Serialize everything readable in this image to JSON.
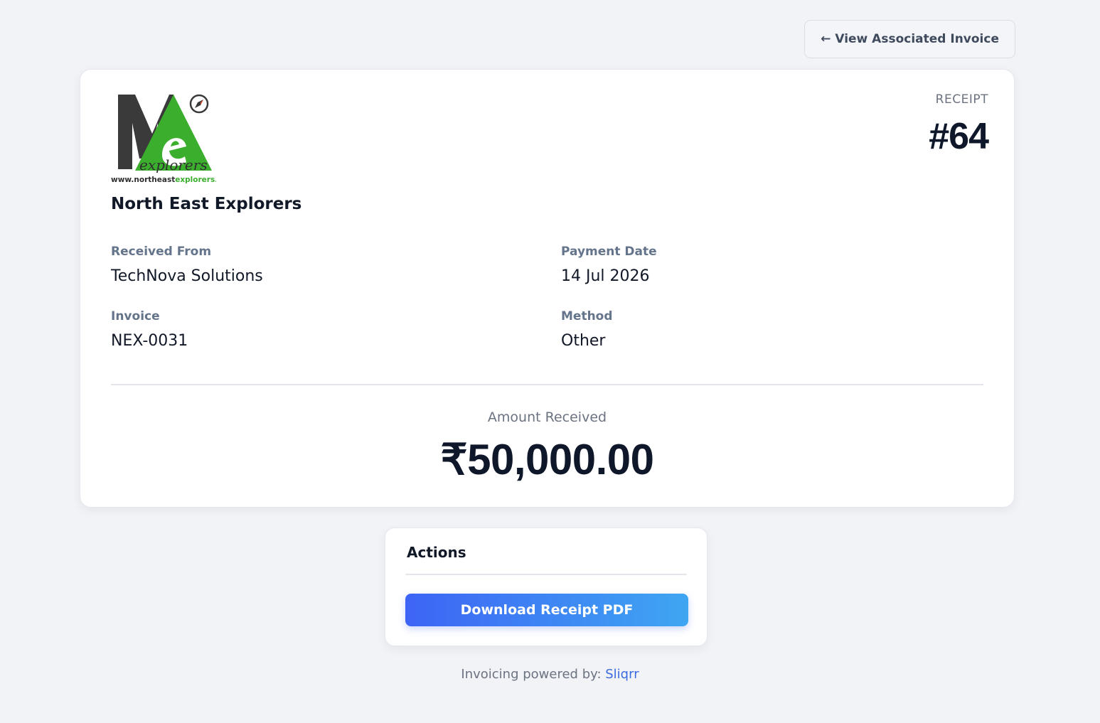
{
  "header": {
    "back_button_label": "← View Associated Invoice"
  },
  "receipt": {
    "logo": {
      "wordmark": "explorers",
      "url_text_prefix": "www.northeast",
      "url_text_suffix": "explorers.in"
    },
    "company_name": "North East Explorers",
    "label": "RECEIPT",
    "number": "#64",
    "fields": {
      "received_from": {
        "label": "Received From",
        "value": "TechNova Solutions"
      },
      "payment_date": {
        "label": "Payment Date",
        "value": "14 Jul 2026"
      },
      "invoice": {
        "label": "Invoice",
        "value": "NEX-0031"
      },
      "method": {
        "label": "Method",
        "value": "Other"
      }
    },
    "amount_label": "Amount Received",
    "amount_value": "₹50,000.00"
  },
  "actions": {
    "title": "Actions",
    "download_label": "Download Receipt PDF"
  },
  "footer": {
    "text": "Invoicing powered by: ",
    "link_text": "Sliqrr"
  },
  "colors": {
    "logo_dark": "#3a3a3a",
    "logo_green": "#3cae2e",
    "accent_start": "#3d64f5",
    "accent_end": "#3fa6f2",
    "link": "#3b6be0"
  }
}
